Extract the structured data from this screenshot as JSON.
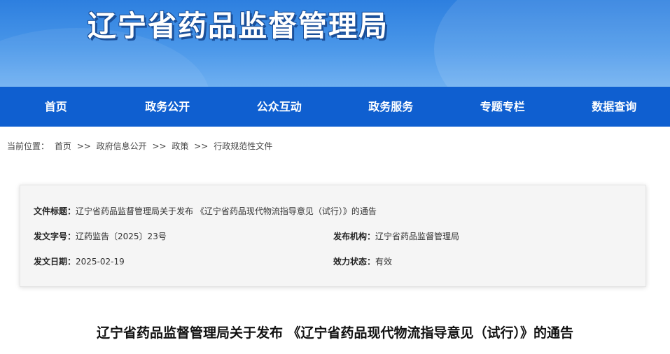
{
  "header": {
    "site_title": "辽宁省药品监督管理局"
  },
  "nav": {
    "items": [
      "首页",
      "政务公开",
      "公众互动",
      "政务服务",
      "专题专栏",
      "数据查询"
    ]
  },
  "breadcrumb": {
    "prefix": "当前位置：",
    "items": [
      "首页",
      "政府信息公开",
      "政策",
      "行政规范性文件"
    ],
    "separator": ">>"
  },
  "info": {
    "title_label": "文件标题：",
    "title_value": "辽宁省药品监督管理局关于发布 《辽宁省药品现代物流指导意见（试行）》的通告",
    "docno_label": "发文字号：",
    "docno_value": "辽药监告〔2025〕23号",
    "issuer_label": "发布机构：",
    "issuer_value": "辽宁省药品监督管理局",
    "date_label": "发文日期：",
    "date_value": "2025-02-19",
    "status_label": "效力状态：",
    "status_value": "有效"
  },
  "article": {
    "title": "辽宁省药品监督管理局关于发布 《辽宁省药品现代物流指导意见（试行）》的通告"
  },
  "colors": {
    "nav_bg": "#0f5fd0",
    "header_top": "#2d7fdf",
    "header_bottom": "#6fb0f1"
  }
}
